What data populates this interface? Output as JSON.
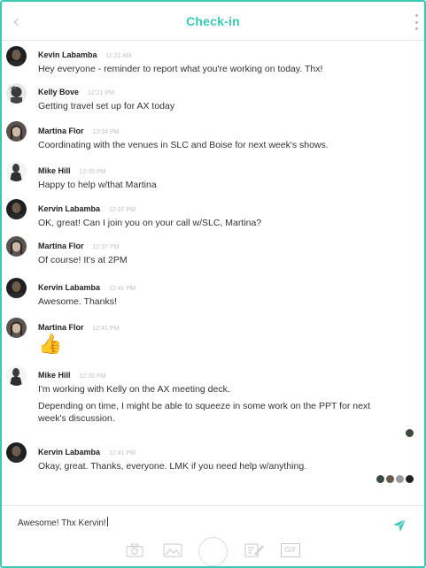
{
  "header": {
    "title": "Check-in",
    "back_icon": "chevron-left-icon",
    "more_icon": "more-vertical-icon"
  },
  "colors": {
    "accent": "#3bc9b4",
    "frame": "#3bc9b4",
    "time": "#c2c2c2"
  },
  "messages": [
    {
      "name": "Kevin Labamba",
      "time": "11:21 AM",
      "text": "Hey everyone - reminder to report what you're working on today. Thx!"
    },
    {
      "name": "Kelly Bove",
      "time": "12:21 PM",
      "text": "Getting travel set up for AX today"
    },
    {
      "name": "Martina Flor",
      "time": "12:34 PM",
      "text": "Coordinating with the venues in SLC and Boise for next week's shows."
    },
    {
      "name": "Mike Hill",
      "time": "12:35 PM",
      "text": "Happy to help w/that Martina"
    },
    {
      "name": "Kervin Labamba",
      "time": "12:37 PM",
      "text": "OK, great! Can I join you on your call w/SLC, Martina?"
    },
    {
      "name": "Martina Flor",
      "time": "12:37 PM",
      "text": "Of course! It's at 2PM"
    },
    {
      "name": "Kervin Labamba",
      "time": "12:41 PM",
      "text": "Awesome. Thanks!"
    },
    {
      "name": "Martina Flor",
      "time": "12:41 PM",
      "text": "👍"
    },
    {
      "name": "Mike Hill",
      "time": "12:35 PM",
      "text": "I'm working with Kelly on the AX meeting deck.",
      "text2": "Depending on time, I might be able to squeeze in some work on the PPT for next week's discussion."
    },
    {
      "name": "Kervin Labamba",
      "time": "12:41 PM",
      "text": "Okay, great. Thanks, everyone. LMK if you need help w/anything."
    }
  ],
  "composer": {
    "value": "Awesome! Thx Kervin!",
    "send_icon": "send-icon",
    "tools": [
      "camera-icon",
      "image-icon",
      "capture-button",
      "edit-icon",
      "gif-icon"
    ],
    "gif_label": "GIF"
  }
}
